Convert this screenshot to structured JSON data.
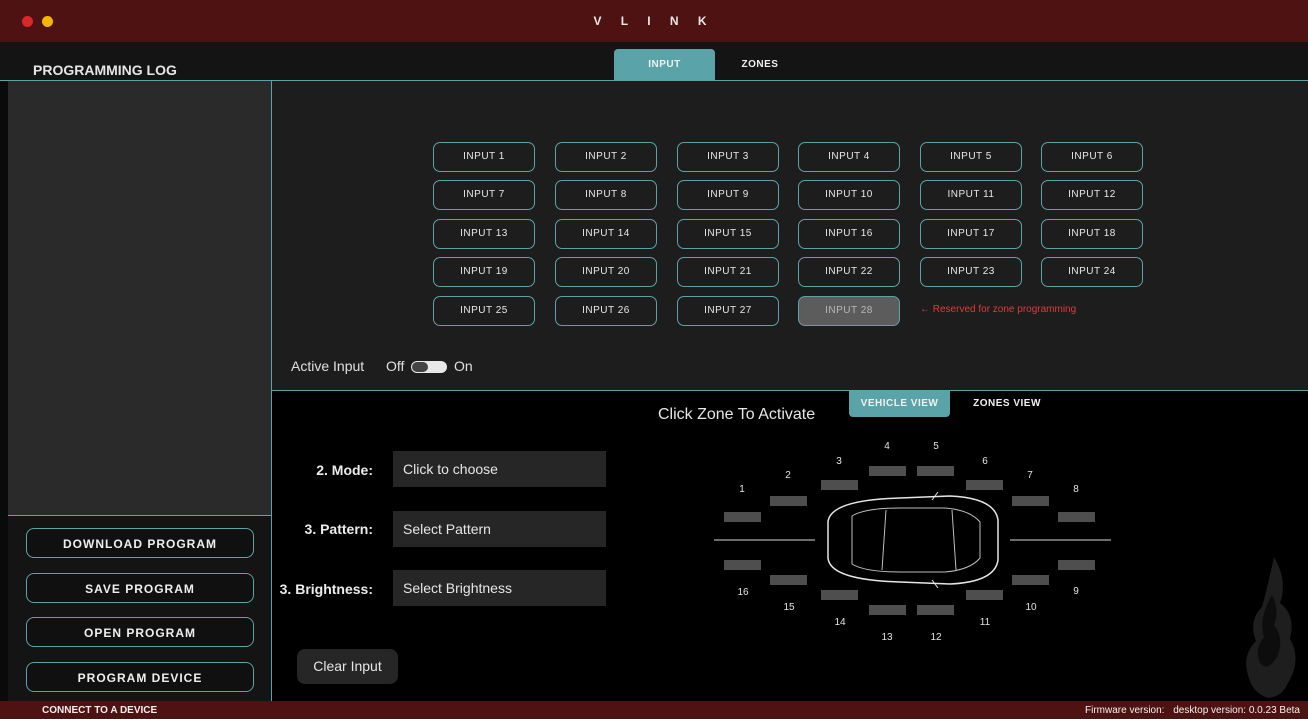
{
  "window": {
    "title": "V L I N K",
    "colors": {
      "accent": "#5aa3a8",
      "brand": "#4f1212",
      "reserved_text": "#e03a3a"
    }
  },
  "sidebar": {
    "title": "PROGRAMMING LOG",
    "buttons": [
      "DOWNLOAD PROGRAM",
      "SAVE PROGRAM",
      "OPEN PROGRAM",
      "PROGRAM DEVICE"
    ]
  },
  "tabs": {
    "input": "INPUT",
    "zones": "ZONES",
    "selected": "INPUT"
  },
  "inputs": {
    "labels": [
      "INPUT 1",
      "INPUT 2",
      "INPUT 3",
      "INPUT 4",
      "INPUT 5",
      "INPUT 6",
      "INPUT 7",
      "INPUT 8",
      "INPUT 9",
      "INPUT 10",
      "INPUT 11",
      "INPUT 12",
      "INPUT 13",
      "INPUT 14",
      "INPUT 15",
      "INPUT 16",
      "INPUT 17",
      "INPUT 18",
      "INPUT 19",
      "INPUT 20",
      "INPUT 21",
      "INPUT 22",
      "INPUT 23",
      "INPUT 24",
      "INPUT 25",
      "INPUT 26",
      "INPUT 27",
      "INPUT 28"
    ],
    "reserved_input": "INPUT 28",
    "reserved_note": "← Reserved for zone programming"
  },
  "active_input": {
    "label": "Active Input",
    "off": "Off",
    "on": "On",
    "state": "Off"
  },
  "view_tabs": {
    "vehicle": "VEHICLE VIEW",
    "zones": "ZONES VIEW",
    "selected": "VEHICLE VIEW"
  },
  "zone_area": {
    "title": "Click Zone To Activate",
    "zone_numbers": [
      "1",
      "2",
      "3",
      "4",
      "5",
      "6",
      "7",
      "8",
      "9",
      "10",
      "11",
      "12",
      "13",
      "14",
      "15",
      "16"
    ]
  },
  "form": {
    "mode": {
      "label": "2. Mode:",
      "value": "Click to choose"
    },
    "pattern": {
      "label": "3. Pattern:",
      "value": "Select Pattern"
    },
    "brightness": {
      "label": "3. Brightness:",
      "value": "Select Brightness"
    },
    "clear_button": "Clear Input"
  },
  "status": {
    "connection": "CONNECT TO A DEVICE",
    "firmware_label": "Firmware version:",
    "desktop_version": "desktop version: 0.0.23 Beta"
  }
}
